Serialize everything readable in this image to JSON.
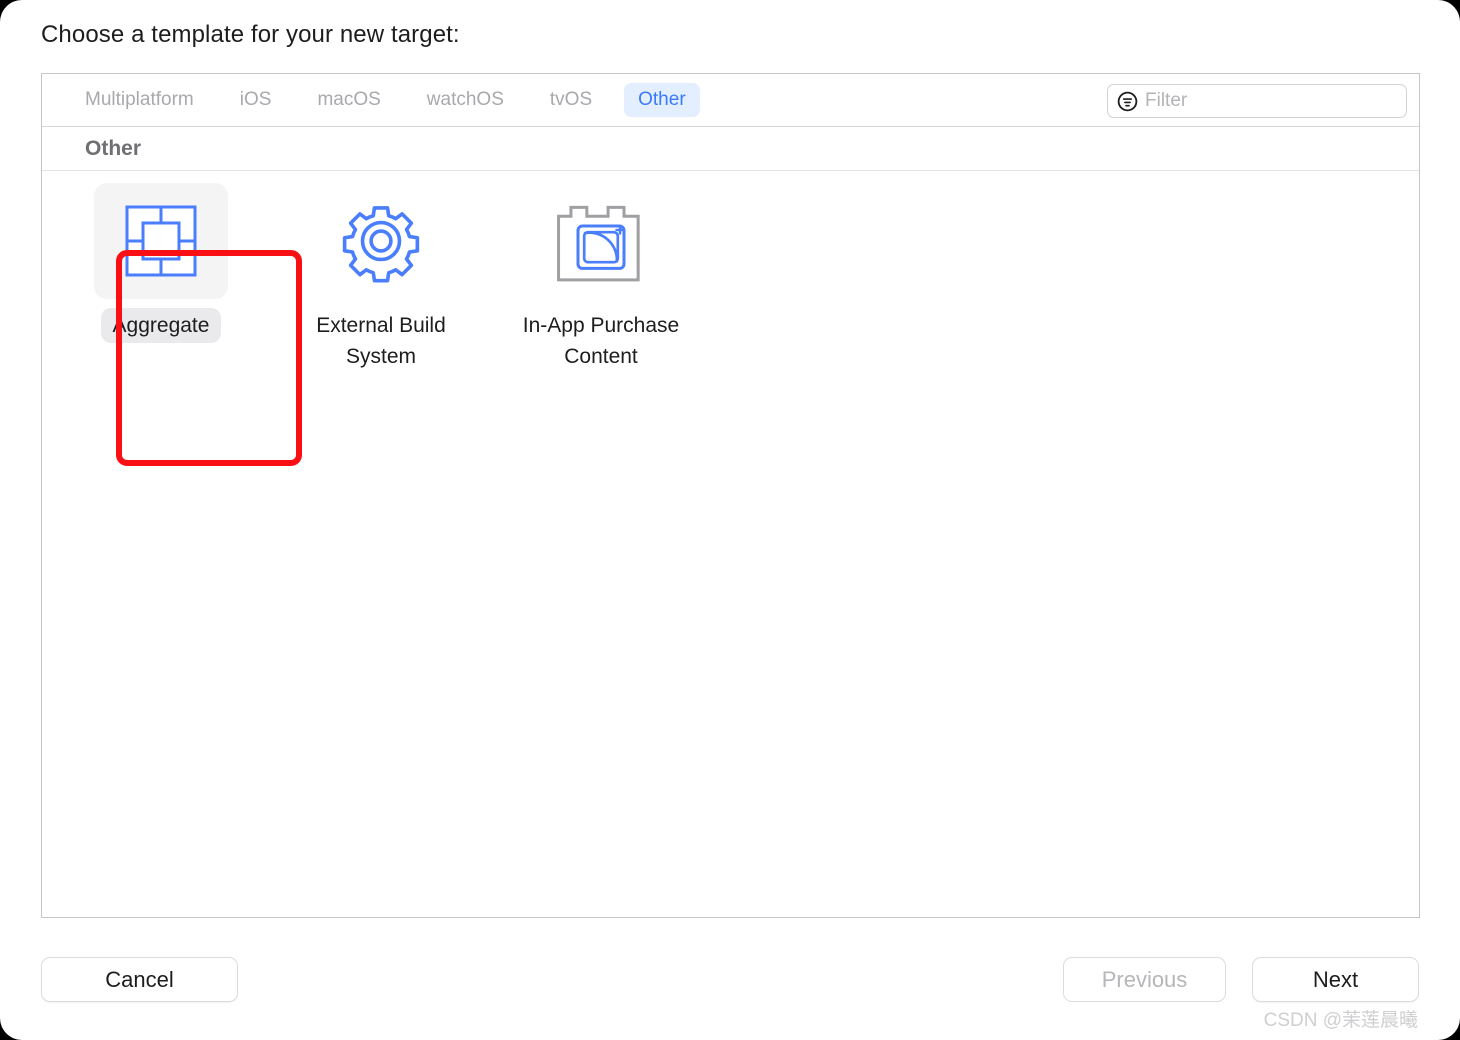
{
  "dialog": {
    "title": "Choose a template for your new target:"
  },
  "tabs": [
    {
      "label": "Multiplatform",
      "selected": false
    },
    {
      "label": "iOS",
      "selected": false
    },
    {
      "label": "macOS",
      "selected": false
    },
    {
      "label": "watchOS",
      "selected": false
    },
    {
      "label": "tvOS",
      "selected": false
    },
    {
      "label": "Other",
      "selected": true
    }
  ],
  "filter": {
    "icon": "filter-icon",
    "value": "",
    "placeholder": "Filter"
  },
  "section": {
    "header": "Other"
  },
  "templates": [
    {
      "label": "Aggregate",
      "icon": "aggregate-icon",
      "selected": true
    },
    {
      "label": "External Build System",
      "icon": "gear-icon",
      "selected": false
    },
    {
      "label": "In-App Purchase Content",
      "icon": "in-app-purchase-icon",
      "selected": false
    }
  ],
  "footer": {
    "cancel_label": "Cancel",
    "previous_label": "Previous",
    "next_label": "Next",
    "previous_disabled": true
  },
  "watermark": {
    "text": "CSDN @茉莲晨曦"
  },
  "colors": {
    "accent_blue": "#3a7afe",
    "tab_selected_bg": "#e3effe",
    "highlight_red": "#fa0f14",
    "selected_tile_bg": "#f4f4f5",
    "disabled_text": "#b6b6b9"
  }
}
